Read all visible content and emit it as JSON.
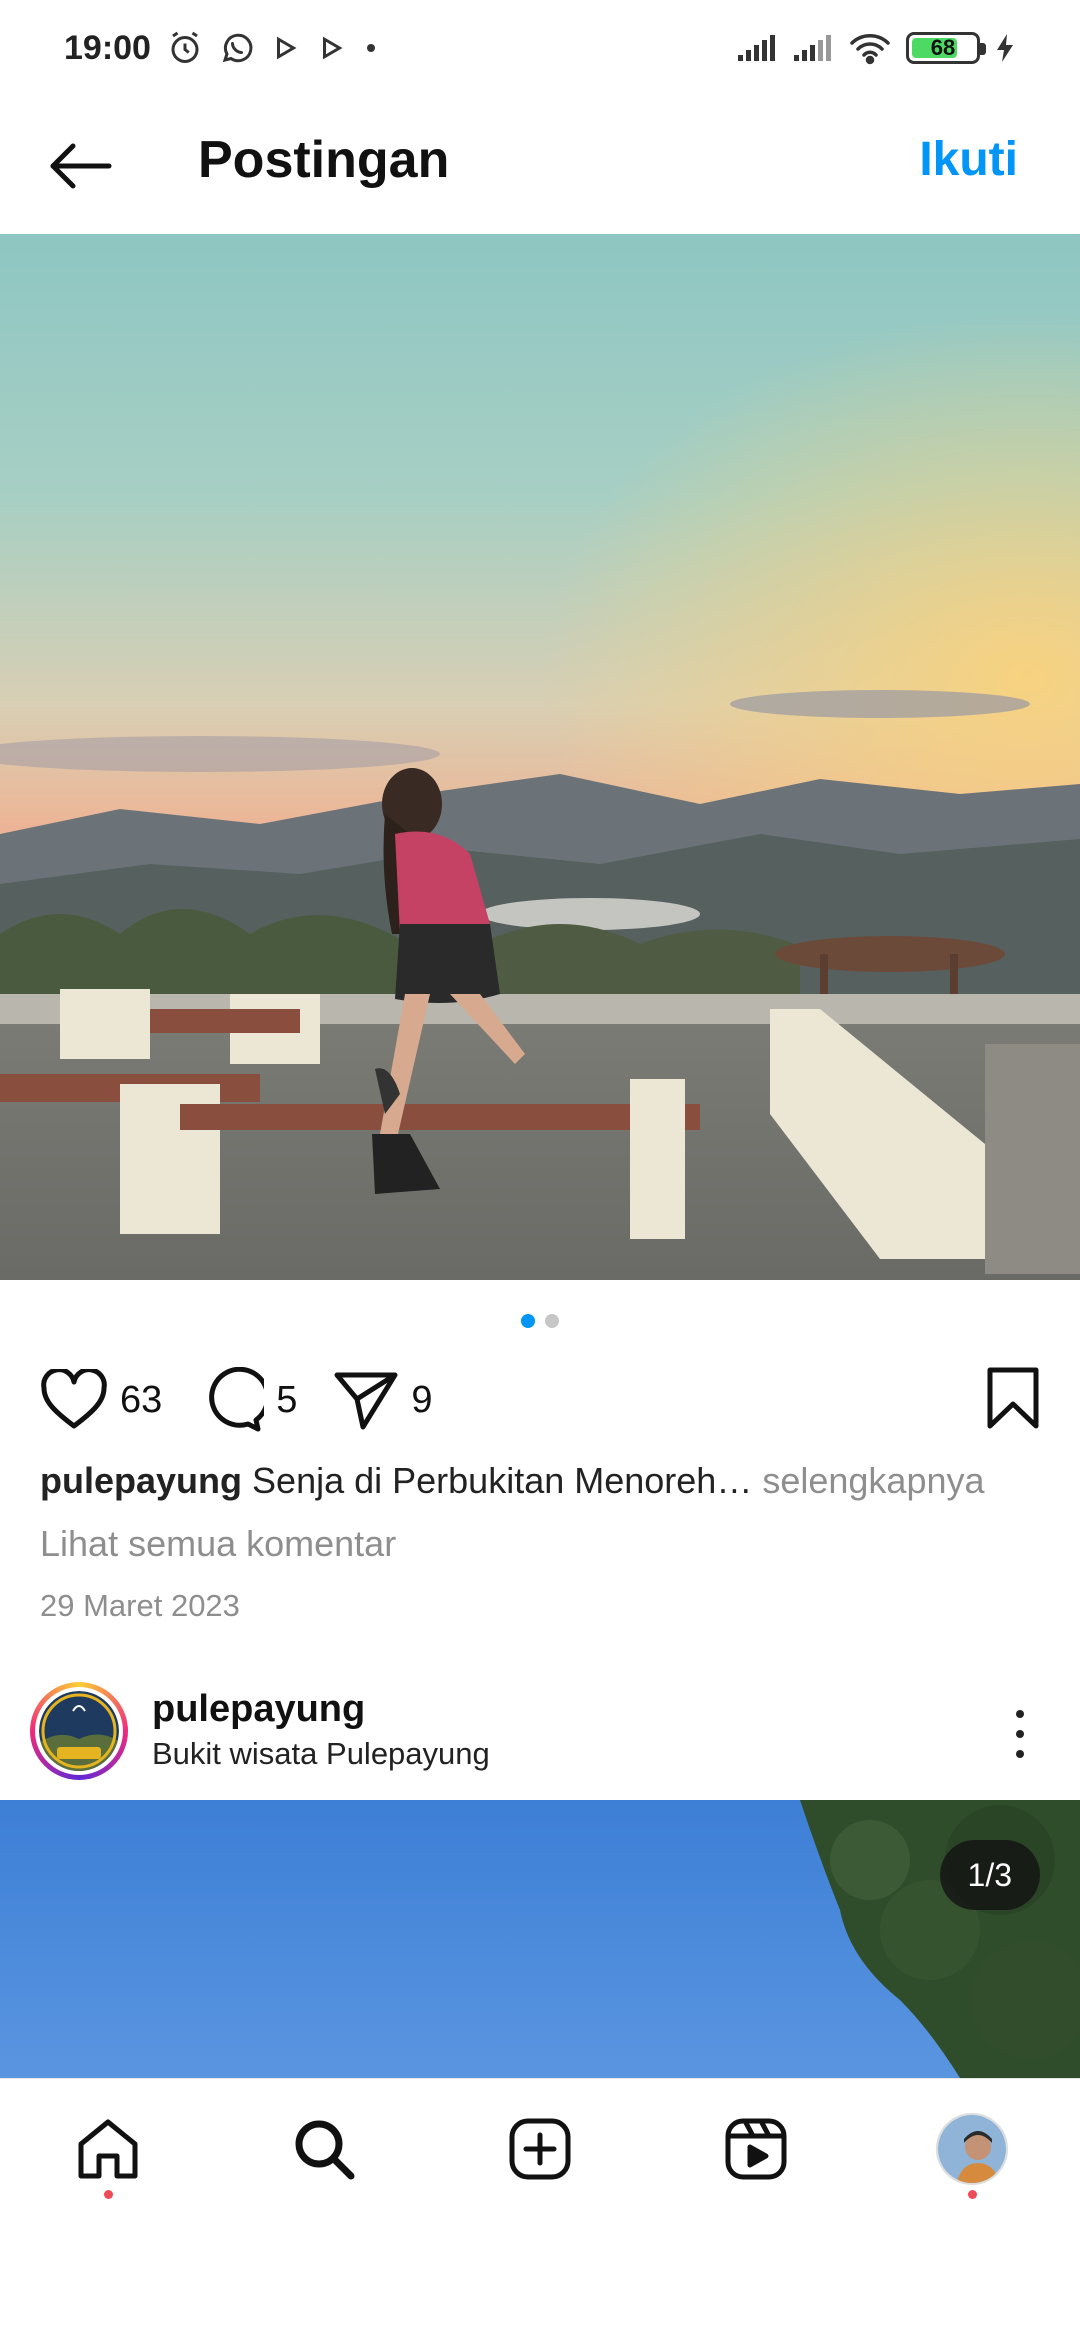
{
  "status_bar": {
    "time": "19:00",
    "battery": "68",
    "battery_level": 0.68
  },
  "header": {
    "title": "Postingan",
    "follow_label": "Ikuti"
  },
  "post": {
    "carousel_dots": 2,
    "active_dot": 0,
    "likes": "63",
    "comments": "5",
    "shares": "9",
    "caption_username": "pulepayung",
    "caption_text": "Senja di Perbukitan Menoreh…",
    "caption_more": "selengkapnya",
    "view_all_comments": "Lihat semua komentar",
    "date": "29 Maret 2023"
  },
  "next_post": {
    "username": "pulepayung",
    "location": "Bukit wisata Pulepayung",
    "image_counter": "1/3"
  },
  "bottom_nav": {
    "items": [
      "home-icon",
      "search-icon",
      "create-post-icon",
      "reels-icon",
      "profile-avatar"
    ]
  },
  "colors": {
    "accent": "#0095f6",
    "notification_dot": "#ed4956",
    "muted_text": "#8e8e8e"
  }
}
